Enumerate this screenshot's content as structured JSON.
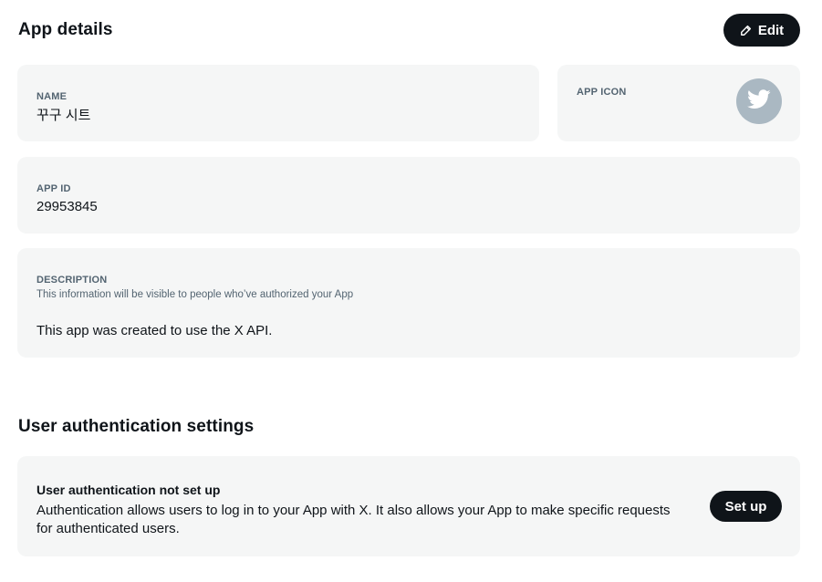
{
  "app_details": {
    "title": "App details",
    "edit_label": "Edit",
    "name": {
      "label": "NAME",
      "value": "꾸구 시트"
    },
    "icon": {
      "label": "APP ICON",
      "icon": "twitter-bird-icon"
    },
    "app_id": {
      "label": "APP ID",
      "value": "29953845"
    },
    "description": {
      "label": "DESCRIPTION",
      "hint": "This information will be visible to people who’ve authorized your App",
      "value": "This app was created to use the X API."
    }
  },
  "user_auth": {
    "title": "User authentication settings",
    "status_title": "User authentication not set up",
    "status_desc": "Authentication allows users to log in to your App with X. It also allows your App to make specific requests for authenticated users.",
    "setup_label": "Set up"
  },
  "colors": {
    "card_bg": "#f5f6f6",
    "button_bg": "#0f1419",
    "icon_bg": "#aab8c2",
    "label_gray": "#536471"
  }
}
